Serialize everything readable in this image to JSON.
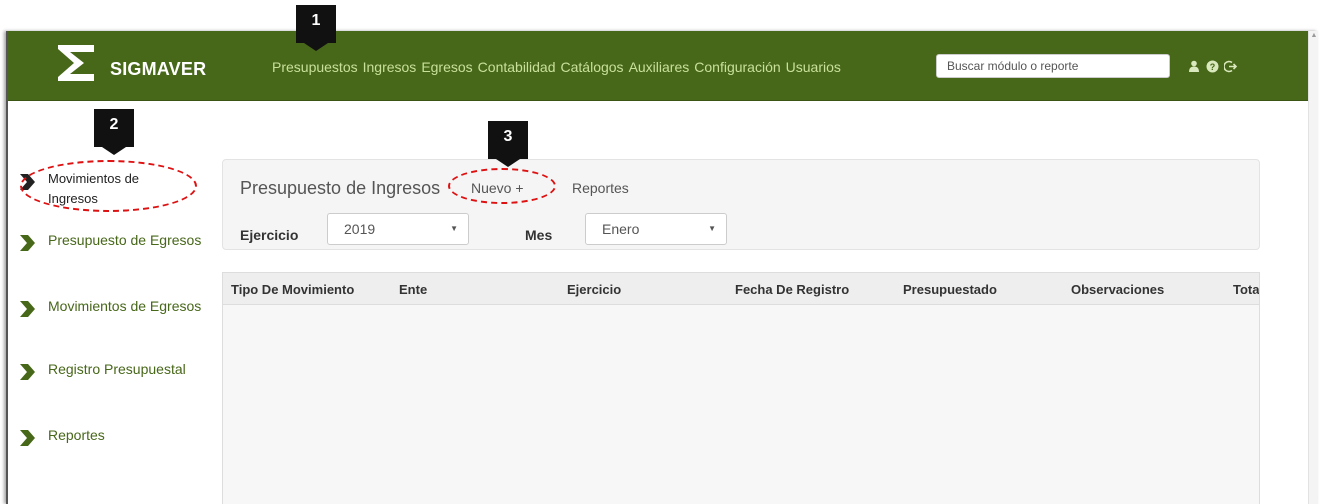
{
  "navbar": {
    "brand": "SIGMAVER",
    "menu": [
      "Presupuestos",
      "Ingresos",
      "Egresos",
      "Contabilidad",
      "Catálogos",
      "Auxiliares",
      "Configuración",
      "Usuarios"
    ],
    "search_placeholder": "Buscar módulo o reporte",
    "icons": [
      "user-icon",
      "help-icon",
      "logout-icon"
    ],
    "background": "#476719",
    "menu_color": "#c8e09a"
  },
  "sidebar": {
    "items": [
      {
        "label": "Movimientos de Ingresos",
        "active": true
      },
      {
        "label": "Presupuesto de Egresos",
        "active": false
      },
      {
        "label": "Movimientos de Egresos",
        "active": false
      },
      {
        "label": "Registro Presupuestal",
        "active": false
      },
      {
        "label": "Reportes",
        "active": false
      }
    ]
  },
  "panel": {
    "title": "Presupuesto de Ingresos",
    "new_link": "Nuevo +",
    "reports_link": "Reportes",
    "ejercicio_label": "Ejercicio",
    "ejercicio_value": "2019",
    "mes_label": "Mes",
    "mes_value": "Enero"
  },
  "table": {
    "columns": [
      "Tipo De Movimiento",
      "Ente",
      "Ejercicio",
      "Fecha De Registro",
      "Presupuestado",
      "Observaciones",
      "Total"
    ],
    "rows": []
  },
  "annotations": [
    "1",
    "2",
    "3"
  ]
}
